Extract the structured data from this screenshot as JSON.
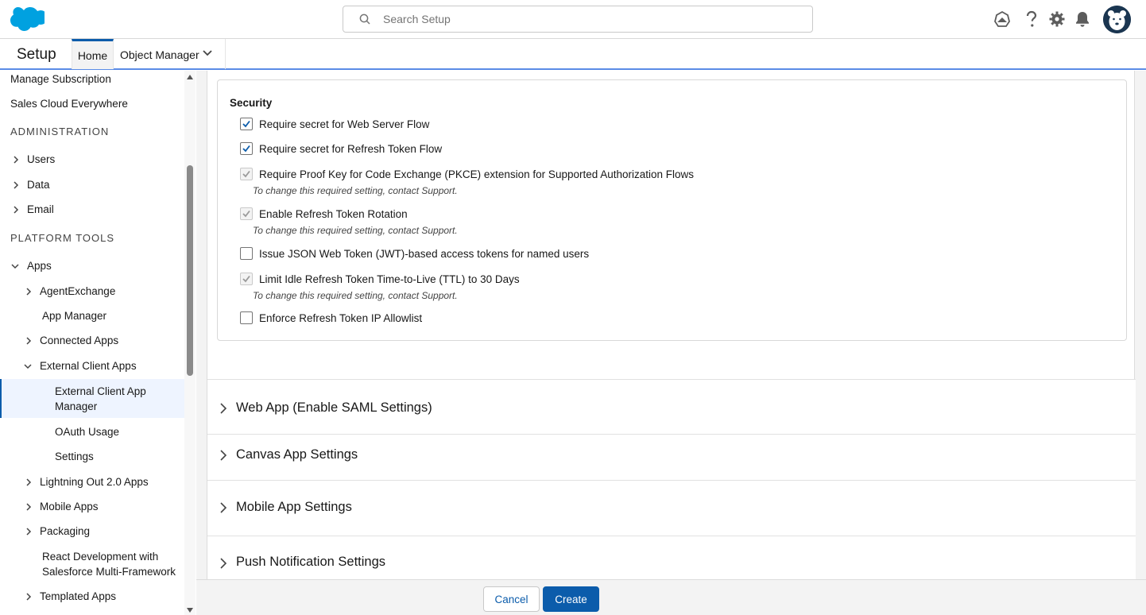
{
  "header": {
    "search_placeholder": "Search Setup",
    "icons": [
      "trailhead-icon",
      "help-icon",
      "gear-icon",
      "bell-icon",
      "avatar"
    ]
  },
  "nav": {
    "app_name": "Setup",
    "tabs": [
      {
        "label": "Home",
        "active": true
      },
      {
        "label": "Object Manager",
        "active": false
      }
    ]
  },
  "sidebar": {
    "items": [
      {
        "label": "Manage Subscription"
      },
      {
        "label": "Sales Cloud Everywhere"
      },
      {
        "label": "ADMINISTRATION"
      },
      {
        "label": "Users"
      },
      {
        "label": "Data"
      },
      {
        "label": "Email"
      },
      {
        "label": "PLATFORM TOOLS"
      },
      {
        "label": "Apps"
      },
      {
        "label": "AgentExchange"
      },
      {
        "label": "App Manager"
      },
      {
        "label": "Connected Apps"
      },
      {
        "label": "External Client Apps"
      },
      {
        "label": "External Client App"
      },
      {
        "label": "Manager"
      },
      {
        "label": "OAuth Usage"
      },
      {
        "label": "Settings"
      },
      {
        "label": "Lightning Out 2.0 Apps"
      },
      {
        "label": "Mobile Apps"
      },
      {
        "label": "Packaging"
      },
      {
        "label": "React Development with"
      },
      {
        "label": "Salesforce Multi-Framework"
      },
      {
        "label": "Templated Apps"
      }
    ]
  },
  "security": {
    "title": "Security",
    "options": [
      {
        "label": "Require secret for Web Server Flow",
        "checked": true,
        "disabled": false,
        "note": ""
      },
      {
        "label": "Require secret for Refresh Token Flow",
        "checked": true,
        "disabled": false,
        "note": ""
      },
      {
        "label": "Require Proof Key for Code Exchange (PKCE) extension for Supported Authorization Flows",
        "checked": true,
        "disabled": true,
        "note": "To change this required setting, contact Support."
      },
      {
        "label": "Enable Refresh Token Rotation",
        "checked": true,
        "disabled": true,
        "note": "To change this required setting, contact Support."
      },
      {
        "label": "Issue JSON Web Token (JWT)-based access tokens for named users",
        "checked": false,
        "disabled": false,
        "note": ""
      },
      {
        "label": "Limit Idle Refresh Token Time-to-Live (TTL) to 30 Days",
        "checked": true,
        "disabled": true,
        "note": "To change this required setting, contact Support."
      },
      {
        "label": "Enforce Refresh Token IP Allowlist",
        "checked": false,
        "disabled": false,
        "note": ""
      }
    ]
  },
  "sections": [
    {
      "label": "Web App (Enable SAML Settings)"
    },
    {
      "label": "Canvas App Settings"
    },
    {
      "label": "Mobile App Settings"
    },
    {
      "label": "Push Notification Settings"
    }
  ],
  "footer": {
    "cancel_label": "Cancel",
    "create_label": "Create"
  },
  "colors": {
    "brand": "#0b5cab",
    "salesforce_cloud": "#00a1e0",
    "nav_underline": "#5b8ce6"
  }
}
